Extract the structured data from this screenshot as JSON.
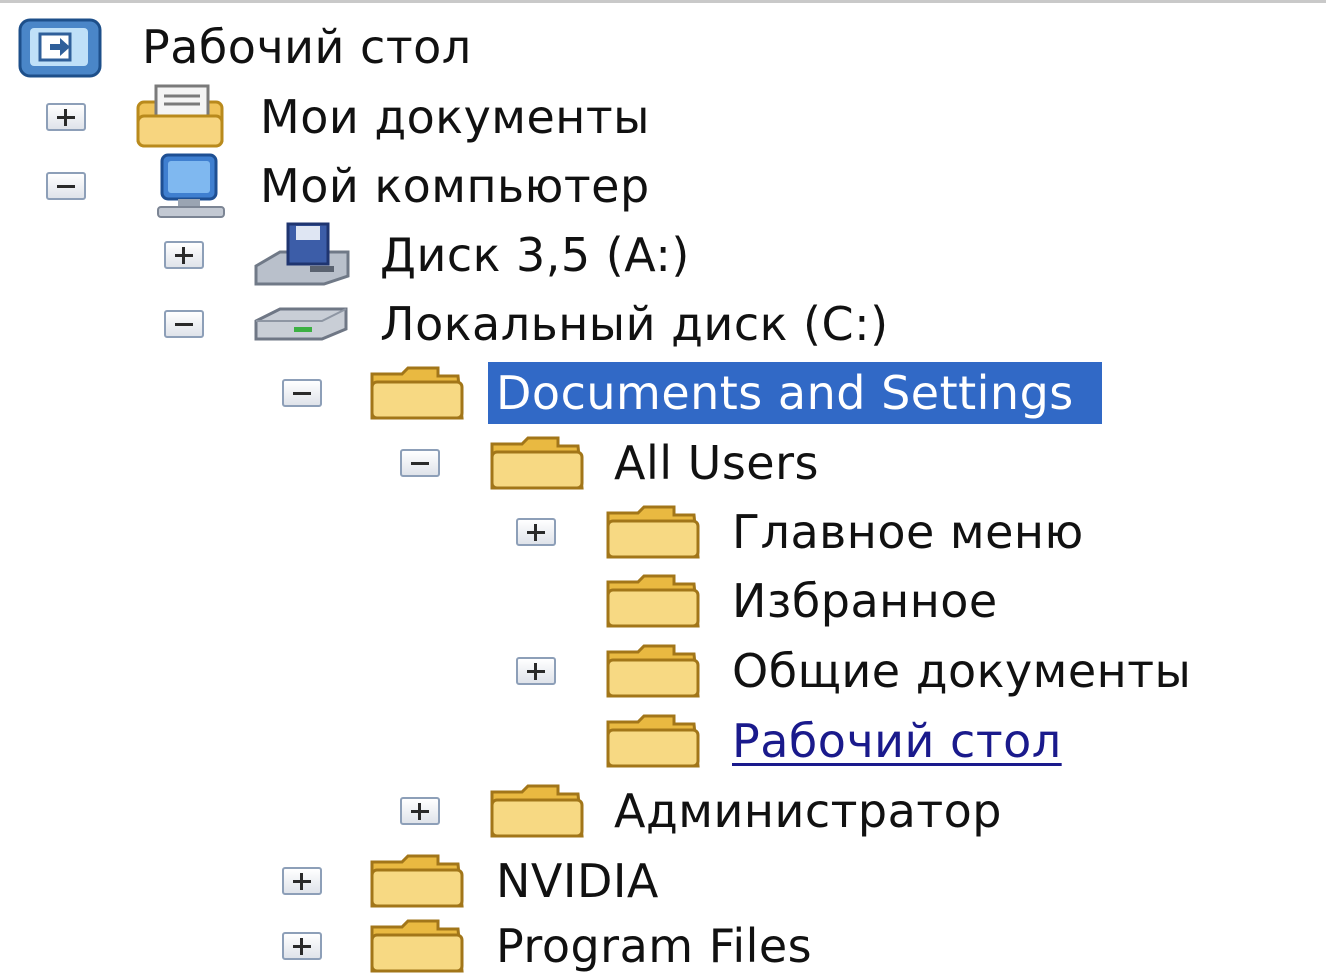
{
  "tree": {
    "desktop": {
      "label": "Рабочий стол",
      "icon": "desktop-icon"
    },
    "my_documents": {
      "label": "Мои документы",
      "icon": "my-documents-icon",
      "state": "collapsed"
    },
    "my_computer": {
      "label": "Мой компьютер",
      "icon": "my-computer-icon",
      "state": "expanded"
    },
    "floppy": {
      "label": "Диск 3,5 (A:)",
      "icon": "floppy-drive-icon",
      "state": "collapsed"
    },
    "local_disk": {
      "label": "Локальный диск (C:)",
      "icon": "hard-drive-icon",
      "state": "expanded"
    },
    "documents_and_settings": {
      "label": "Documents and Settings",
      "icon": "folder-icon",
      "state": "expanded",
      "selected": true
    },
    "all_users": {
      "label": "All Users",
      "icon": "folder-icon",
      "state": "expanded"
    },
    "main_menu": {
      "label": "Главное меню",
      "icon": "folder-icon",
      "state": "collapsed"
    },
    "favorites": {
      "label": "Избранное",
      "icon": "folder-icon"
    },
    "shared_documents": {
      "label": "Общие документы",
      "icon": "folder-icon",
      "state": "collapsed"
    },
    "all_users_desktop": {
      "label": "Рабочий стол",
      "icon": "folder-icon",
      "hovered": true
    },
    "administrator": {
      "label": "Администратор",
      "icon": "folder-icon",
      "state": "collapsed"
    },
    "nvidia": {
      "label": "NVIDIA",
      "icon": "folder-icon",
      "state": "collapsed"
    },
    "program_files": {
      "label": "Program Files",
      "icon": "folder-icon",
      "state": "collapsed"
    }
  },
  "colors": {
    "selection": "#3169c6",
    "hover_link": "#1a1a8c",
    "folder": "#f4d27a"
  }
}
